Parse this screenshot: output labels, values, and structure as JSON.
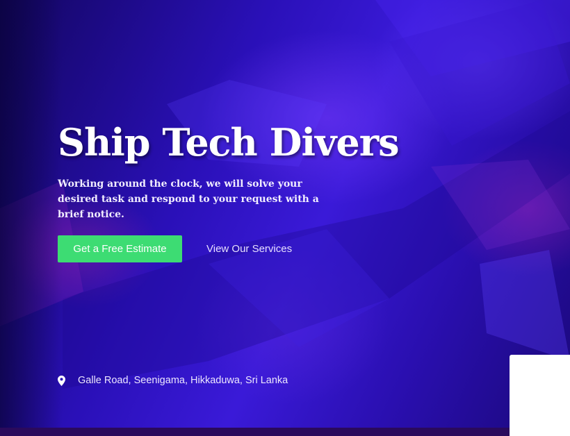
{
  "hero": {
    "title": "Ship Tech Divers",
    "subtitle": "Working around the clock, we will solve your desired task and respond to your request with a brief notice.",
    "primary_button": "Get a Free Estimate",
    "secondary_link": "View Our Services",
    "address": "Galle Road, Seenigama, Hikkaduwa, Sri Lanka",
    "address_icon": "map-pin-icon"
  },
  "colors": {
    "primary_button": "#3ddc73",
    "background": "#2a10b8",
    "text": "#ffffff"
  }
}
